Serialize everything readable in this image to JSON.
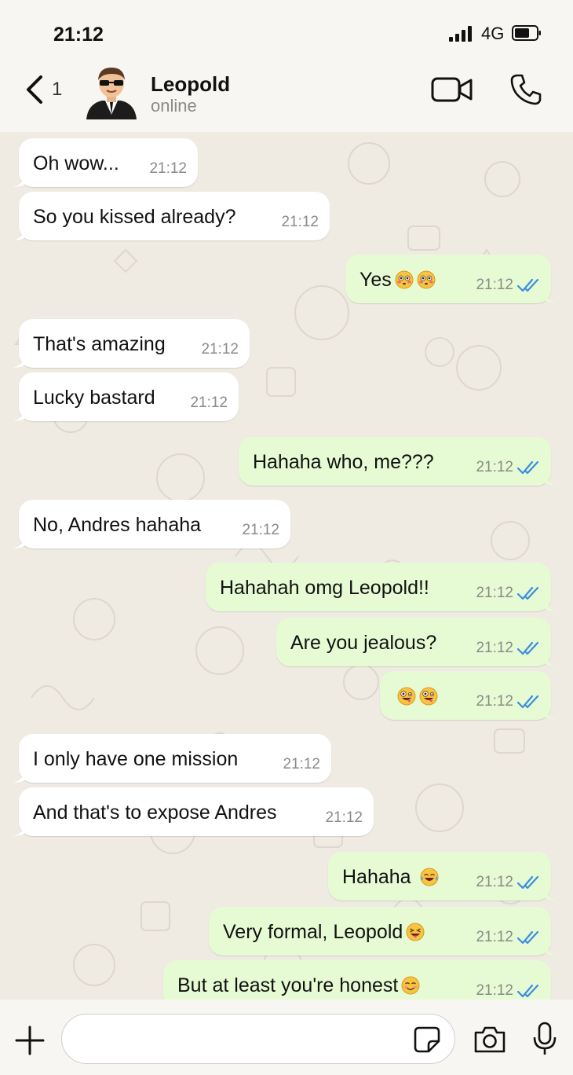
{
  "status_bar": {
    "time": "21:12",
    "network": "4G"
  },
  "header": {
    "unread_count": "1",
    "contact_name": "Leopold",
    "contact_status": "online"
  },
  "colors": {
    "incoming_bubble": "#ffffff",
    "outgoing_bubble": "#e6fbd4",
    "read_ticks": "#3a8de0",
    "chat_background": "#efebe3"
  },
  "messages": [
    {
      "dir": "in",
      "text": "Oh wow...",
      "time": "21:12"
    },
    {
      "dir": "in",
      "text": "So you kissed already?",
      "time": "21:12"
    },
    {
      "dir": "out",
      "text": "Yes",
      "emojis": [
        "flushed-face",
        "flushed-face"
      ],
      "time": "21:12",
      "read": true
    },
    {
      "dir": "in",
      "text": "That's amazing",
      "time": "21:12"
    },
    {
      "dir": "in",
      "text": "Lucky bastard",
      "time": "21:12"
    },
    {
      "dir": "out",
      "text": "Hahaha who, me???",
      "time": "21:12",
      "read": true
    },
    {
      "dir": "in",
      "text": "No, Andres hahaha",
      "time": "21:12"
    },
    {
      "dir": "out",
      "text": "Hahahah omg Leopold!!",
      "time": "21:12",
      "read": true
    },
    {
      "dir": "out",
      "text": "Are you jealous?",
      "time": "21:12",
      "read": true
    },
    {
      "dir": "out",
      "text": "",
      "emojis": [
        "zany-face",
        "zany-face"
      ],
      "time": "21:12",
      "read": true
    },
    {
      "dir": "in",
      "text": "I only have one mission",
      "time": "21:12"
    },
    {
      "dir": "in",
      "text": "And that's to expose Andres",
      "time": "21:12"
    },
    {
      "dir": "out",
      "text": "Hahaha ",
      "emojis": [
        "tears-of-joy-face"
      ],
      "time": "21:12",
      "read": true
    },
    {
      "dir": "out",
      "text": "Very formal, Leopold",
      "emojis": [
        "squinting-tongue-face"
      ],
      "time": "21:12",
      "read": true
    },
    {
      "dir": "out",
      "text": "But at least you're honest",
      "emojis": [
        "smiling-blush-face"
      ],
      "time": "21:12",
      "read": true
    }
  ],
  "composer": {
    "value": "",
    "placeholder": ""
  },
  "icons": {
    "back": "chevron-left-icon",
    "video": "video-camera-icon",
    "call": "phone-icon",
    "attach": "plus-icon",
    "sticker": "sticker-icon",
    "camera": "camera-icon",
    "mic": "microphone-icon",
    "signal": "signal-bars-icon",
    "battery": "battery-icon",
    "read": "double-check-icon"
  }
}
